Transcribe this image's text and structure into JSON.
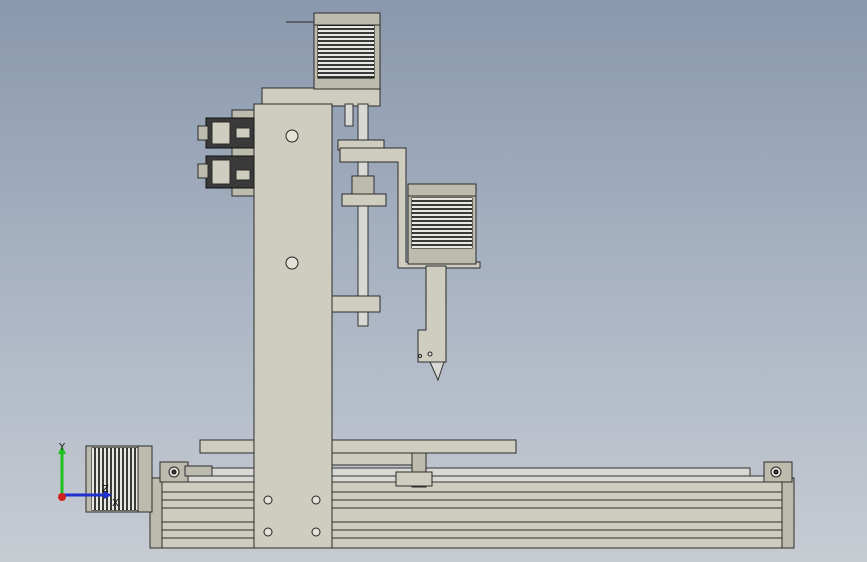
{
  "viewport": {
    "background_top": "#8a98ad",
    "background_bottom": "#c7ccd3",
    "part_color": "#cfcdbf",
    "edge_color": "#2b2b2b"
  },
  "triad": {
    "x_label": "X",
    "y_label": "Y",
    "z_label": "Z",
    "x_color": "#2030d0",
    "y_color": "#20c020",
    "z_color": "#d02020"
  },
  "icons": {
    "origin": "coordinate-triad-icon"
  }
}
